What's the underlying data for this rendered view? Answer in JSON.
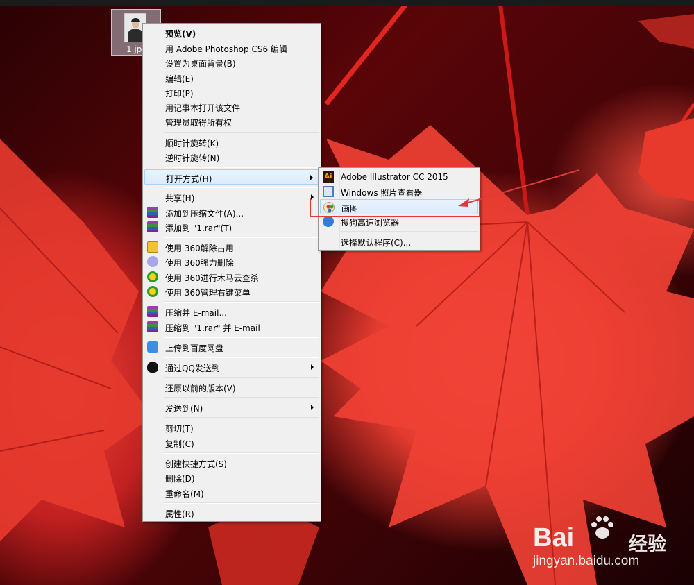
{
  "desktop_icon": {
    "label": "1.jpg"
  },
  "context_menu": {
    "items": [
      {
        "label": "预览(V)",
        "bold": true
      },
      {
        "label": "用 Adobe Photoshop CS6 编辑"
      },
      {
        "label": "设置为桌面背景(B)"
      },
      {
        "label": "编辑(E)"
      },
      {
        "label": "打印(P)"
      },
      {
        "label": "用记事本打开该文件"
      },
      {
        "label": "管理员取得所有权"
      },
      {
        "label": "顺时针旋转(K)"
      },
      {
        "label": "逆时针旋转(N)"
      },
      {
        "label": "打开方式(H)",
        "submenu": true,
        "highlighted": true
      },
      {
        "label": "共享(H)",
        "submenu": true
      },
      {
        "label": "添加到压缩文件(A)...",
        "icon": "winrar-icon"
      },
      {
        "label": "添加到 \"1.rar\"(T)",
        "icon": "winrar-icon"
      },
      {
        "label": "使用 360解除占用",
        "icon": "360-unlock-icon"
      },
      {
        "label": "使用 360强力删除",
        "icon": "360-delete-icon"
      },
      {
        "label": "使用 360进行木马云查杀",
        "icon": "360-scan-icon"
      },
      {
        "label": "使用 360管理右键菜单",
        "icon": "360-manage-icon"
      },
      {
        "label": "压缩并 E-mail...",
        "icon": "winrar-icon"
      },
      {
        "label": "压缩到 \"1.rar\" 并 E-mail",
        "icon": "winrar-icon"
      },
      {
        "label": "上传到百度网盘",
        "icon": "baidu-netdisk-icon"
      },
      {
        "label": "通过QQ发送到",
        "icon": "qq-icon",
        "submenu": true
      },
      {
        "label": "还原以前的版本(V)"
      },
      {
        "label": "发送到(N)",
        "submenu": true
      },
      {
        "label": "剪切(T)"
      },
      {
        "label": "复制(C)"
      },
      {
        "label": "创建快捷方式(S)"
      },
      {
        "label": "删除(D)"
      },
      {
        "label": "重命名(M)"
      },
      {
        "label": "属性(R)"
      }
    ]
  },
  "open_with_submenu": {
    "items": [
      {
        "label": "Adobe Illustrator CC 2015",
        "icon": "illustrator-icon"
      },
      {
        "label": "Windows 照片查看器",
        "icon": "photo-viewer-icon"
      },
      {
        "label": "画图",
        "icon": "paint-icon",
        "highlighted": true
      },
      {
        "label": "搜狗高速浏览器",
        "icon": "sogou-browser-icon"
      },
      {
        "label": "选择默认程序(C)..."
      }
    ]
  },
  "icons": {
    "illustrator_text": "Ai"
  },
  "annotation": {
    "color": "#e23a3a"
  },
  "watermark": {
    "brand": "Bai",
    "brand2": "经验",
    "url": "jingyan.baidu.com"
  }
}
